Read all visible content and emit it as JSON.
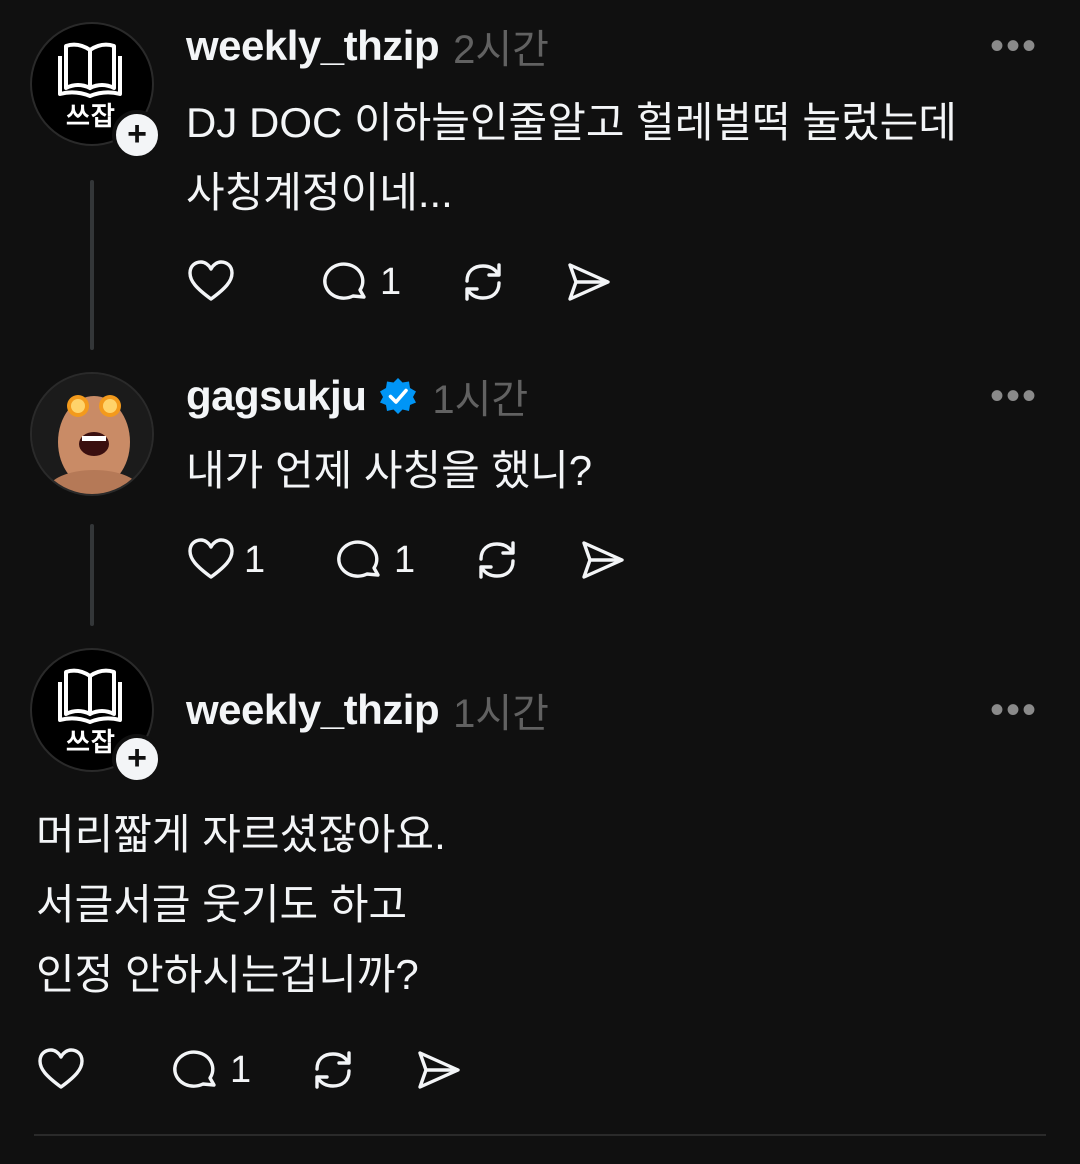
{
  "posts": [
    {
      "username": "weekly_thzip",
      "time": "2시간",
      "avatar_text": "쓰잡",
      "text": "DJ DOC 이하늘인줄알고 헐레벌떡 눌렀는데\n사칭계정이네...",
      "likes": "",
      "replies": "1",
      "verified": false
    },
    {
      "username": "gagsukju",
      "time": "1시간",
      "text": "내가 언제 사칭을 했니?",
      "likes": "1",
      "replies": "1",
      "verified": true
    },
    {
      "username": "weekly_thzip",
      "time": "1시간",
      "avatar_text": "쓰잡",
      "text": "머리짧게 자르셨잖아요.\n서글서글 웃기도 하고\n인정 안하시는겁니까?",
      "likes": "",
      "replies": "1",
      "verified": false
    }
  ],
  "more_label": "•••",
  "plus_label": "+",
  "colors": {
    "background": "#101010",
    "text": "#f3f5f7",
    "muted": "#616161",
    "verified": "#0095f6"
  },
  "icons": [
    "heart-icon",
    "comment-icon",
    "repost-icon",
    "share-icon",
    "verified-icon",
    "book-icon"
  ]
}
